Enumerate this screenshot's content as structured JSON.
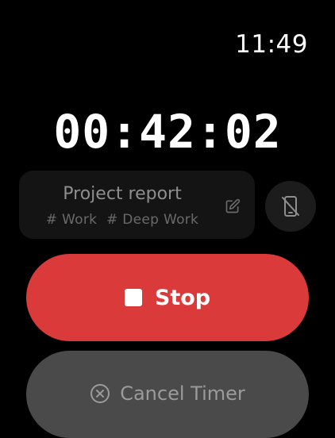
{
  "status_bar": {
    "time": "11:49"
  },
  "timer": {
    "elapsed": "00:42:02"
  },
  "task": {
    "title": "Project report",
    "tags": [
      "# Work",
      "# Deep Work"
    ],
    "edit_icon": "edit-icon"
  },
  "phone_toggle": {
    "icon": "phone-off-icon"
  },
  "stop_button": {
    "label": "Stop",
    "icon": "stop-icon",
    "color": "#db3a3b"
  },
  "cancel_button": {
    "label": "Cancel Timer",
    "icon": "close-circle-icon",
    "color": "#4a4a4a"
  }
}
